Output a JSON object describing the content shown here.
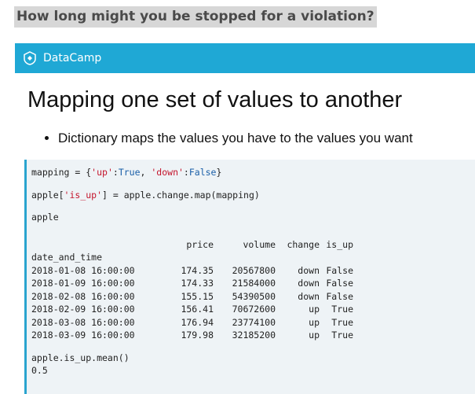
{
  "question": "How long might you be stopped for a violation?",
  "header": {
    "brand": "DataCamp"
  },
  "slide": {
    "title": "Mapping one set of values to another",
    "bullets": [
      "Dictionary maps the values you have to the values you want"
    ]
  },
  "code": {
    "line1": {
      "a": "mapping = {",
      "s1": "'up'",
      "b": ":",
      "k1": "True",
      "c": ", ",
      "s2": "'down'",
      "d": ":",
      "k2": "False",
      "e": "}"
    },
    "line2": {
      "a": "apple[",
      "s1": "'is_up'",
      "b": "] = apple.change.map(mapping)"
    },
    "line3": "apple",
    "table": {
      "columns": [
        "price",
        "volume",
        "change",
        "is_up"
      ],
      "index_name": "date_and_time",
      "rows": [
        [
          "2018-01-08 16:00:00",
          "174.35",
          "20567800",
          "down",
          "False"
        ],
        [
          "2018-01-09 16:00:00",
          "174.33",
          "21584000",
          "down",
          "False"
        ],
        [
          "2018-02-08 16:00:00",
          "155.15",
          "54390500",
          "down",
          "False"
        ],
        [
          "2018-02-09 16:00:00",
          "156.41",
          "70672600",
          "up",
          "True"
        ],
        [
          "2018-03-08 16:00:00",
          "176.94",
          "23774100",
          "up",
          "True"
        ],
        [
          "2018-03-09 16:00:00",
          "179.98",
          "32185200",
          "up",
          "True"
        ]
      ]
    },
    "line4": "apple.is_up.mean()",
    "line5": "0.5"
  },
  "colors": {
    "header_bg": "#1fa8d5",
    "code_bg": "#eef3f6",
    "code_border": "#2aa4cf",
    "string": "#c4152c",
    "keyword": "#1a5fa8"
  }
}
